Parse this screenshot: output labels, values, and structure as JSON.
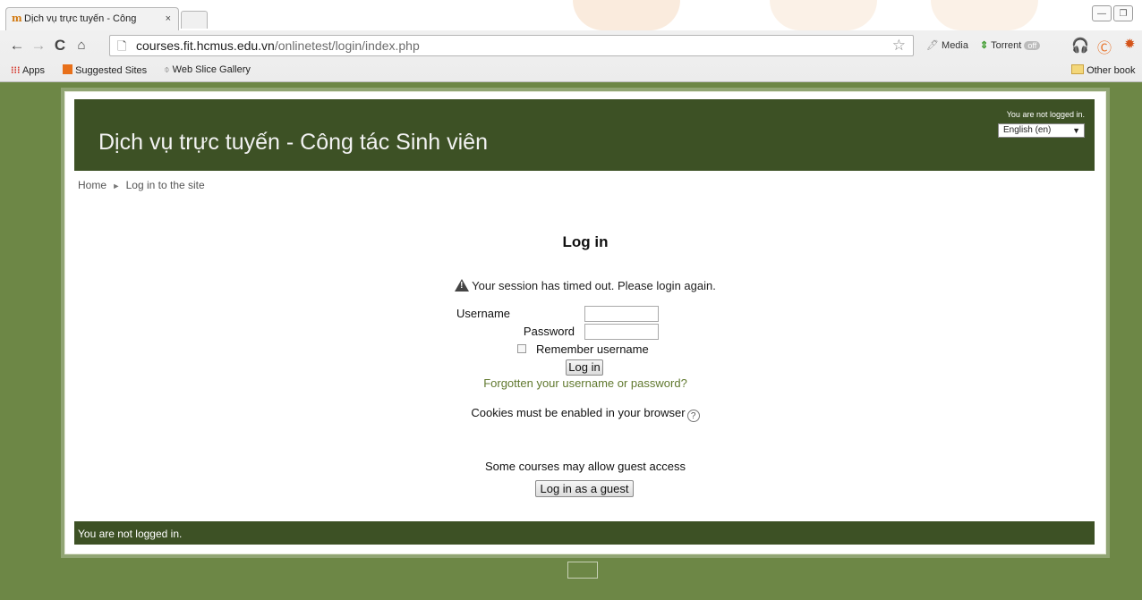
{
  "browser": {
    "tab_title": "Dịch vụ trực tuyến - Công",
    "tab_close": "×",
    "url_host": "courses.fit.hcmus.edu.vn",
    "url_path": "/onlinetest/login/index.php",
    "extensions": {
      "media": "Media",
      "torrent": "Torrent",
      "torrent_badge": "off"
    },
    "bookmarks": {
      "apps": "Apps",
      "suggested": "Suggested Sites",
      "web_slice": "Web Slice Gallery",
      "other": "Other book"
    }
  },
  "header": {
    "site_title": "Dịch vụ trực tuyến - Công tác Sinh viên",
    "login_status": "You are not logged in.",
    "language": "English (en)"
  },
  "breadcrumb": {
    "home": "Home",
    "separator": "►",
    "current": "Log in to the site"
  },
  "login": {
    "title": "Log in",
    "timeout_message": "Your session has timed out. Please login again.",
    "username_label": "Username",
    "username_value": "",
    "password_label": "Password",
    "password_value": "",
    "remember_label": "Remember username",
    "remember_checked": false,
    "submit_label": "Log in",
    "forgot_link": "Forgotten your username or password?",
    "cookies_message": "Cookies must be enabled in your browser",
    "guest_message": "Some courses may allow guest access",
    "guest_button": "Log in as a guest"
  },
  "footer": {
    "login_status": "You are not logged in."
  },
  "colors": {
    "header_bg": "#3d5125",
    "page_bg": "#6d8746",
    "link": "#61792f"
  }
}
